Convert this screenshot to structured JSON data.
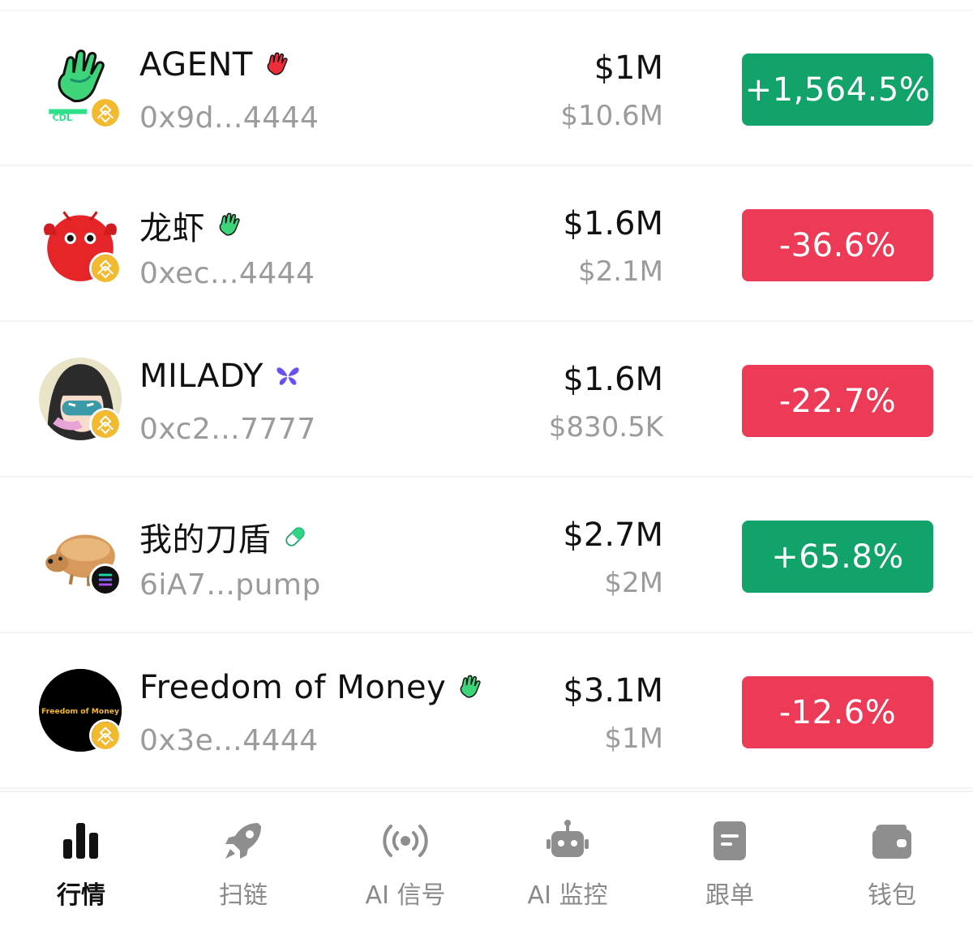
{
  "tokens": [
    {
      "name": "AGENT",
      "address": "0x9d...4444",
      "market_cap": "$1M",
      "volume": "$10.6M",
      "change": "+1,564.5%",
      "direction": "up",
      "chain": "bnb",
      "tag_icon": "red-hand-icon",
      "avatar_icon": "green-hand-logo"
    },
    {
      "name": "龙虾",
      "address": "0xec...4444",
      "market_cap": "$1.6M",
      "volume": "$2.1M",
      "change": "-36.6%",
      "direction": "down",
      "chain": "bnb",
      "tag_icon": "green-hand-icon",
      "avatar_icon": "red-lobster-avatar"
    },
    {
      "name": "MILADY",
      "address": "0xc2...7777",
      "market_cap": "$1.6M",
      "volume": "$830.5K",
      "change": "-22.7%",
      "direction": "down",
      "chain": "bnb",
      "tag_icon": "butterfly-icon",
      "avatar_icon": "milady-avatar"
    },
    {
      "name": "我的刀盾",
      "address": "6iA7...pump",
      "market_cap": "$2.7M",
      "volume": "$2M",
      "change": "+65.8%",
      "direction": "up",
      "chain": "solana",
      "tag_icon": "pill-icon",
      "avatar_icon": "bread-dog-avatar"
    },
    {
      "name": "Freedom of Money",
      "address": "0x3e...4444",
      "market_cap": "$3.1M",
      "volume": "$1M",
      "change": "-12.6%",
      "direction": "down",
      "chain": "bnb",
      "tag_icon": "green-hand-icon",
      "avatar_icon": "freedom-of-money-logo",
      "avatar_text": "Freedom of Money"
    }
  ],
  "colors": {
    "up": "#12a36a",
    "down": "#ec3a57",
    "bnb": "#f3ba2f",
    "secondary_text": "#9b9b9b"
  },
  "tabs": [
    {
      "label": "行情",
      "icon": "bar-chart-icon",
      "active": true
    },
    {
      "label": "扫链",
      "icon": "rocket-icon",
      "active": false
    },
    {
      "label": "AI 信号",
      "icon": "signal-icon",
      "active": false
    },
    {
      "label": "AI 监控",
      "icon": "robot-icon",
      "active": false
    },
    {
      "label": "跟单",
      "icon": "document-icon",
      "active": false
    },
    {
      "label": "钱包",
      "icon": "wallet-icon",
      "active": false
    }
  ]
}
